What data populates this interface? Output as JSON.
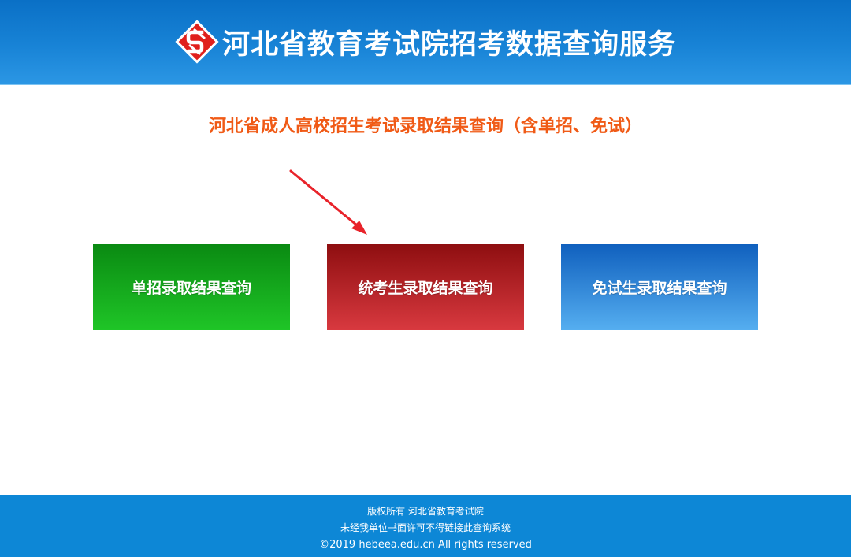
{
  "header": {
    "logo_icon": "hebeea-logo-icon",
    "title": "河北省教育考试院招考数据查询服务"
  },
  "main": {
    "title": "河北省成人高校招生考试录取结果查询（含单招、免试）",
    "annotation_icon": "red-arrow-icon",
    "buttons": [
      {
        "label": "单招录取结果查询",
        "color": "#1aa521"
      },
      {
        "label": "统考生录取结果查询",
        "color": "#b5262b"
      },
      {
        "label": "免试生录取结果查询",
        "color": "#2f88db"
      }
    ]
  },
  "footer": {
    "line1": "版权所有 河北省教育考试院",
    "line2": "未经我单位书面许可不得链接此查询系统",
    "line3": "©2019 hebeea.edu.cn All rights reserved"
  },
  "colors": {
    "header_blue": "#1883d6",
    "title_orange": "#f05a16",
    "footer_blue": "#0d87d6"
  }
}
